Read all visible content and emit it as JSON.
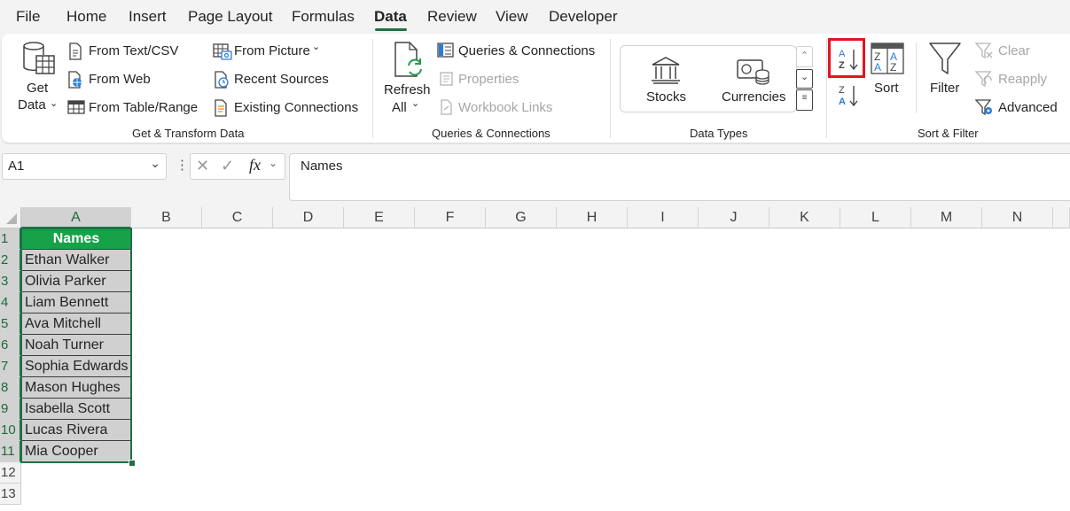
{
  "menu": {
    "tabs": [
      "File",
      "Home",
      "Insert",
      "Page Layout",
      "Formulas",
      "Data",
      "Review",
      "View",
      "Developer"
    ],
    "active": "Data"
  },
  "ribbon": {
    "get_transform": {
      "get_data_line1": "Get",
      "get_data_line2": "Data",
      "from_text_csv": "From Text/CSV",
      "from_web": "From Web",
      "from_table_range": "From Table/Range",
      "from_picture": "From Picture",
      "recent_sources": "Recent Sources",
      "existing_connections": "Existing Connections",
      "group_label": "Get & Transform Data"
    },
    "queries": {
      "refresh_line1": "Refresh",
      "refresh_line2": "All",
      "queries_connections": "Queries & Connections",
      "properties": "Properties",
      "workbook_links": "Workbook Links",
      "group_label": "Queries & Connections"
    },
    "data_types": {
      "stocks": "Stocks",
      "currencies": "Currencies",
      "group_label": "Data Types"
    },
    "sort_filter": {
      "sort": "Sort",
      "filter": "Filter",
      "clear": "Clear",
      "reapply": "Reapply",
      "advanced": "Advanced",
      "group_label": "Sort & Filter",
      "highlight_color": "#e81123"
    }
  },
  "formula_bar": {
    "name_box": "A1",
    "fx": "fx",
    "content": "Names"
  },
  "sheet": {
    "columns": [
      "A",
      "B",
      "C",
      "D",
      "E",
      "F",
      "G",
      "H",
      "I",
      "J",
      "K",
      "L",
      "M",
      "N"
    ],
    "rows": [
      "1",
      "2",
      "3",
      "4",
      "5",
      "6",
      "7",
      "8",
      "9",
      "10",
      "11",
      "12",
      "13"
    ],
    "header": "Names",
    "names": [
      "Ethan Walker",
      "Olivia Parker",
      "Liam Bennett",
      "Ava Mitchell",
      "Noah Turner",
      "Sophia Edwards",
      "Mason Hughes",
      "Isabella Scott",
      "Lucas Rivera",
      "Mia Cooper"
    ],
    "header_color": "#17a24a",
    "selection_color": "#1e7145"
  }
}
